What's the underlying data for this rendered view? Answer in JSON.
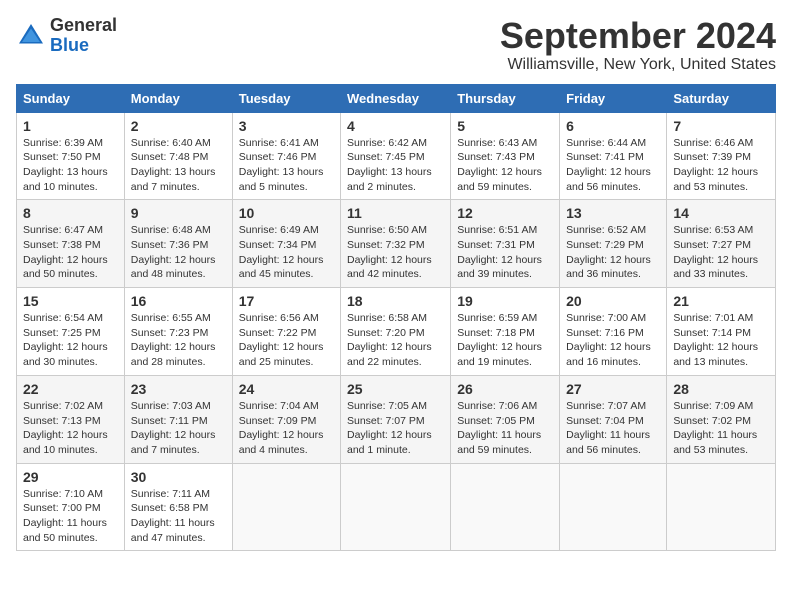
{
  "logo": {
    "general": "General",
    "blue": "Blue"
  },
  "title": "September 2024",
  "subtitle": "Williamsville, New York, United States",
  "days_of_week": [
    "Sunday",
    "Monday",
    "Tuesday",
    "Wednesday",
    "Thursday",
    "Friday",
    "Saturday"
  ],
  "weeks": [
    [
      {
        "day": "1",
        "sunrise": "6:39 AM",
        "sunset": "7:50 PM",
        "daylight": "13 hours and 10 minutes."
      },
      {
        "day": "2",
        "sunrise": "6:40 AM",
        "sunset": "7:48 PM",
        "daylight": "13 hours and 7 minutes."
      },
      {
        "day": "3",
        "sunrise": "6:41 AM",
        "sunset": "7:46 PM",
        "daylight": "13 hours and 5 minutes."
      },
      {
        "day": "4",
        "sunrise": "6:42 AM",
        "sunset": "7:45 PM",
        "daylight": "13 hours and 2 minutes."
      },
      {
        "day": "5",
        "sunrise": "6:43 AM",
        "sunset": "7:43 PM",
        "daylight": "12 hours and 59 minutes."
      },
      {
        "day": "6",
        "sunrise": "6:44 AM",
        "sunset": "7:41 PM",
        "daylight": "12 hours and 56 minutes."
      },
      {
        "day": "7",
        "sunrise": "6:46 AM",
        "sunset": "7:39 PM",
        "daylight": "12 hours and 53 minutes."
      }
    ],
    [
      {
        "day": "8",
        "sunrise": "6:47 AM",
        "sunset": "7:38 PM",
        "daylight": "12 hours and 50 minutes."
      },
      {
        "day": "9",
        "sunrise": "6:48 AM",
        "sunset": "7:36 PM",
        "daylight": "12 hours and 48 minutes."
      },
      {
        "day": "10",
        "sunrise": "6:49 AM",
        "sunset": "7:34 PM",
        "daylight": "12 hours and 45 minutes."
      },
      {
        "day": "11",
        "sunrise": "6:50 AM",
        "sunset": "7:32 PM",
        "daylight": "12 hours and 42 minutes."
      },
      {
        "day": "12",
        "sunrise": "6:51 AM",
        "sunset": "7:31 PM",
        "daylight": "12 hours and 39 minutes."
      },
      {
        "day": "13",
        "sunrise": "6:52 AM",
        "sunset": "7:29 PM",
        "daylight": "12 hours and 36 minutes."
      },
      {
        "day": "14",
        "sunrise": "6:53 AM",
        "sunset": "7:27 PM",
        "daylight": "12 hours and 33 minutes."
      }
    ],
    [
      {
        "day": "15",
        "sunrise": "6:54 AM",
        "sunset": "7:25 PM",
        "daylight": "12 hours and 30 minutes."
      },
      {
        "day": "16",
        "sunrise": "6:55 AM",
        "sunset": "7:23 PM",
        "daylight": "12 hours and 28 minutes."
      },
      {
        "day": "17",
        "sunrise": "6:56 AM",
        "sunset": "7:22 PM",
        "daylight": "12 hours and 25 minutes."
      },
      {
        "day": "18",
        "sunrise": "6:58 AM",
        "sunset": "7:20 PM",
        "daylight": "12 hours and 22 minutes."
      },
      {
        "day": "19",
        "sunrise": "6:59 AM",
        "sunset": "7:18 PM",
        "daylight": "12 hours and 19 minutes."
      },
      {
        "day": "20",
        "sunrise": "7:00 AM",
        "sunset": "7:16 PM",
        "daylight": "12 hours and 16 minutes."
      },
      {
        "day": "21",
        "sunrise": "7:01 AM",
        "sunset": "7:14 PM",
        "daylight": "12 hours and 13 minutes."
      }
    ],
    [
      {
        "day": "22",
        "sunrise": "7:02 AM",
        "sunset": "7:13 PM",
        "daylight": "12 hours and 10 minutes."
      },
      {
        "day": "23",
        "sunrise": "7:03 AM",
        "sunset": "7:11 PM",
        "daylight": "12 hours and 7 minutes."
      },
      {
        "day": "24",
        "sunrise": "7:04 AM",
        "sunset": "7:09 PM",
        "daylight": "12 hours and 4 minutes."
      },
      {
        "day": "25",
        "sunrise": "7:05 AM",
        "sunset": "7:07 PM",
        "daylight": "12 hours and 1 minute."
      },
      {
        "day": "26",
        "sunrise": "7:06 AM",
        "sunset": "7:05 PM",
        "daylight": "11 hours and 59 minutes."
      },
      {
        "day": "27",
        "sunrise": "7:07 AM",
        "sunset": "7:04 PM",
        "daylight": "11 hours and 56 minutes."
      },
      {
        "day": "28",
        "sunrise": "7:09 AM",
        "sunset": "7:02 PM",
        "daylight": "11 hours and 53 minutes."
      }
    ],
    [
      {
        "day": "29",
        "sunrise": "7:10 AM",
        "sunset": "7:00 PM",
        "daylight": "11 hours and 50 minutes."
      },
      {
        "day": "30",
        "sunrise": "7:11 AM",
        "sunset": "6:58 PM",
        "daylight": "11 hours and 47 minutes."
      },
      null,
      null,
      null,
      null,
      null
    ]
  ],
  "labels": {
    "sunrise": "Sunrise:",
    "sunset": "Sunset:",
    "daylight": "Daylight:"
  }
}
